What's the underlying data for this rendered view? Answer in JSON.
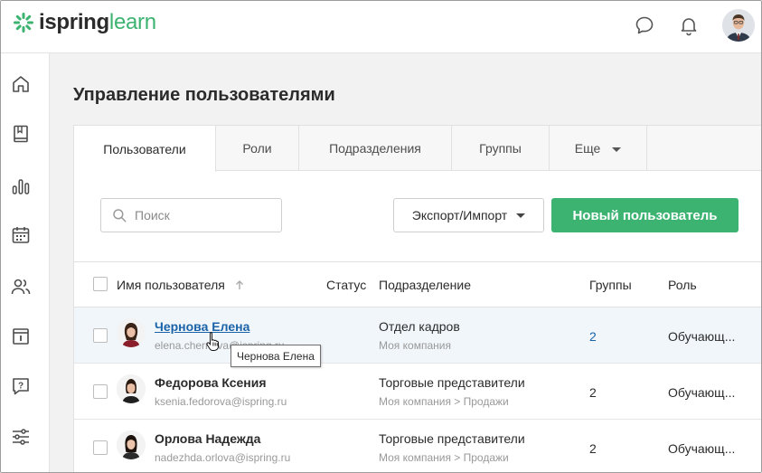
{
  "brand": {
    "logo_part1": "ispring",
    "logo_part2": "learn",
    "accent_color": "#3cb371"
  },
  "header": {
    "icons": [
      "chat-icon",
      "bell-icon",
      "user-avatar"
    ]
  },
  "sidebar": {
    "icons": [
      "home-icon",
      "book-icon",
      "bar-chart-icon",
      "calendar-icon",
      "users-icon",
      "info-card-icon",
      "help-icon",
      "settings-sliders-icon"
    ]
  },
  "page": {
    "title": "Управление пользователями"
  },
  "tabs": [
    {
      "label": "Пользователи",
      "active": true
    },
    {
      "label": "Роли"
    },
    {
      "label": "Подразделения"
    },
    {
      "label": "Группы"
    },
    {
      "label": "Еще"
    }
  ],
  "toolbar": {
    "search_placeholder": "Поиск",
    "export_label": "Экспорт/Импорт",
    "new_user_label": "Новый пользователь"
  },
  "table": {
    "columns": {
      "name": "Имя пользователя",
      "status": "Статус",
      "department": "Подразделение",
      "groups": "Группы",
      "role": "Роль"
    },
    "rows": [
      {
        "name": "Чернова Елена",
        "email": "elena.chernova@ispring.ru",
        "department": "Отдел кадров",
        "path": "Моя компания",
        "groups": "2",
        "role": "Обучающ..."
      },
      {
        "name": "Федорова Ксения",
        "email": "ksenia.fedorova@ispring.ru",
        "department": "Торговые представители",
        "path": "Моя компания > Продажи",
        "groups": "2",
        "role": "Обучающ..."
      },
      {
        "name": "Орлова Надежда",
        "email": "nadezhda.orlova@ispring.ru",
        "department": "Торговые представители",
        "path": "Моя компания > Продажи",
        "groups": "2",
        "role": "Обучающ..."
      }
    ]
  },
  "tooltip": {
    "text": "Чернова Елена"
  }
}
